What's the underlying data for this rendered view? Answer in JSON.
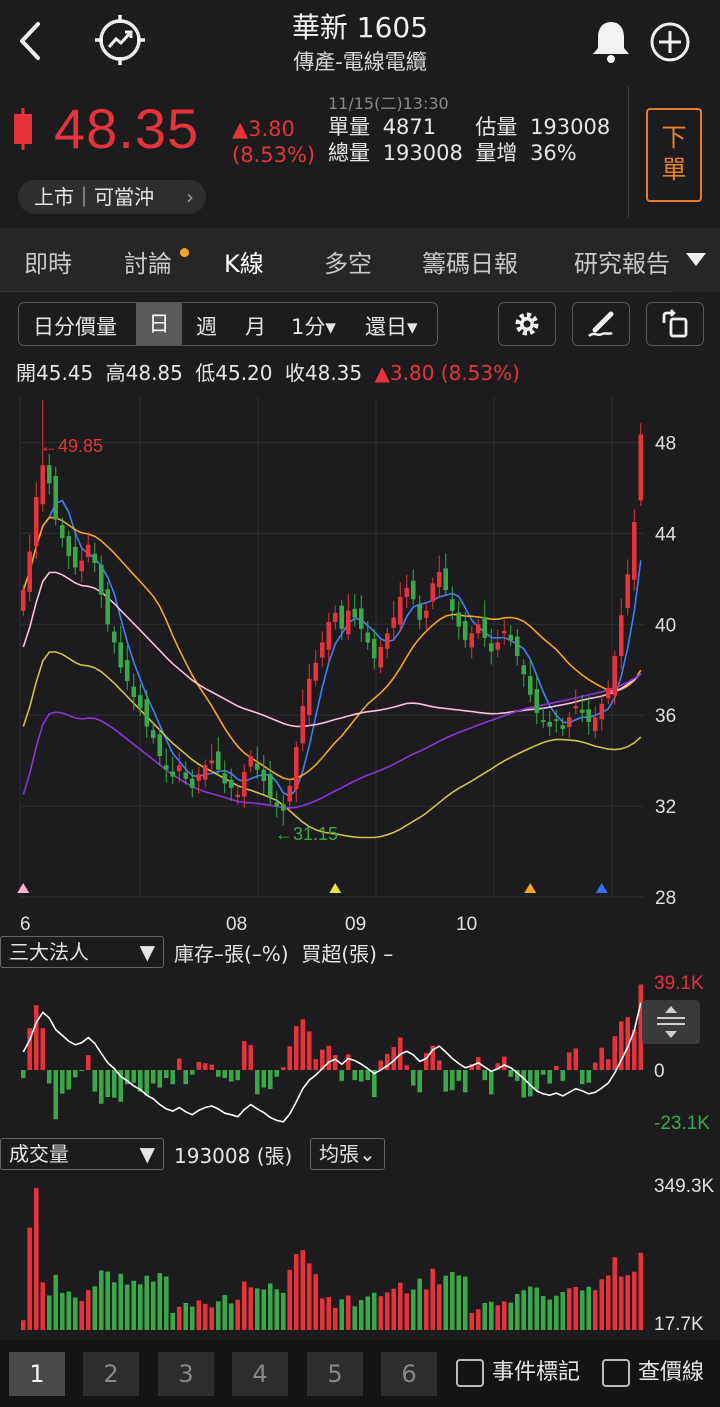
{
  "header": {
    "title": "華新 1605",
    "subtitle": "傳產-電線電纜",
    "icons": [
      "back-icon",
      "trend-compass-icon",
      "bell-icon",
      "plus-circle-icon"
    ]
  },
  "quote": {
    "price": "48.35",
    "change": "▲3.80",
    "change_pct": "(8.53%)",
    "time": "11/15(二)13:30",
    "single_vol_label": "單量",
    "single_vol": "4871",
    "est_label": "估量",
    "est": "193008",
    "total_vol_label": "總量",
    "total_vol": "193008",
    "vol_inc_label": "量增",
    "vol_inc": "36%",
    "order_label_1": "下",
    "order_label_2": "單",
    "market": "上市｜可當沖",
    "colors": {
      "up": "#e5323b",
      "down": "#3aa84a",
      "accent": "#e8802a"
    }
  },
  "tabs": [
    {
      "label": "即時"
    },
    {
      "label": "討論"
    },
    {
      "label": "K線"
    },
    {
      "label": "多空"
    },
    {
      "label": "籌碼日報"
    },
    {
      "label": "研究報告"
    }
  ],
  "toolbar": {
    "periods": [
      "日分價量",
      "日",
      "週",
      "月",
      "1分▾",
      "還日▾"
    ],
    "selected": "日"
  },
  "ohlc": {
    "open_label": "開",
    "open": "45.45",
    "high_label": "高",
    "high": "48.85",
    "low_label": "低",
    "low": "45.20",
    "close_label": "收",
    "close": "48.35",
    "change": "▲3.80 (8.53%)"
  },
  "chart_data": [
    {
      "type": "candlestick",
      "y_ticks": [
        "48",
        "44",
        "40",
        "36",
        "32",
        "28"
      ],
      "ylim": [
        28,
        50
      ],
      "x_ticks": [
        "6",
        "08",
        "09",
        "10"
      ],
      "annotations": {
        "high_mark": "←49.85",
        "low_mark": "←31.15"
      },
      "closes": [
        41.5,
        43.2,
        45.6,
        47.0,
        46.2,
        44.6,
        43.8,
        43.0,
        42.5,
        42.8,
        43.5,
        42.7,
        41.3,
        40.0,
        39.2,
        38.1,
        37.5,
        36.8,
        36.3,
        35.5,
        35.0,
        34.2,
        33.6,
        33.3,
        33.8,
        33.2,
        32.8,
        33.4,
        33.8,
        34.0,
        33.6,
        33.0,
        32.8,
        32.5,
        33.5,
        34.2,
        33.6,
        33.1,
        32.4,
        32.0,
        31.8,
        32.9,
        34.6,
        36.4,
        37.6,
        38.3,
        39.2,
        40.1,
        40.5,
        39.8,
        40.6,
        40.3,
        39.8,
        39.2,
        38.5,
        39.0,
        39.6,
        40.3,
        41.2,
        41.6,
        41.1,
        40.2,
        40.6,
        41.8,
        42.3,
        41.5,
        40.6,
        39.9,
        39.3,
        39.6,
        40.0,
        39.4,
        38.8,
        39.2,
        39.7,
        39.3,
        38.6,
        37.8,
        36.9,
        36.1,
        35.7,
        35.5,
        35.8,
        35.4,
        35.9,
        36.4,
        36.1,
        35.7,
        35.9,
        36.5,
        37.2,
        38.6,
        40.4,
        42.2,
        44.5,
        48.35
      ],
      "ma_series": [
        {
          "color": "#3b82f6"
        },
        {
          "color": "#f5a623"
        },
        {
          "color": "#ffc0e0"
        },
        {
          "color": "#cfc34a"
        },
        {
          "color": "#8b35d6"
        }
      ],
      "signals": [
        {
          "index": 0,
          "color": "#ffb3d9"
        },
        {
          "index": 48,
          "color": "#e8e83a"
        },
        {
          "index": 78,
          "color": "#f5a623"
        },
        {
          "index": 89,
          "color": "#3b6cf6"
        }
      ]
    },
    {
      "type": "bar",
      "y_ticks": [
        "39.1K",
        "0",
        "-23.1K"
      ],
      "ylim": [
        -23.1,
        39.1
      ]
    },
    {
      "type": "bar",
      "y_ticks": [
        "349.3K",
        "17.7K"
      ],
      "ylim": [
        17.7,
        349.3
      ]
    }
  ],
  "institutional": {
    "select": "三大法人",
    "caption": "庫存–張(–%)  買超(張) –"
  },
  "volume": {
    "select": "成交量",
    "value": "193008 (張)",
    "avg_btn": "均張⌄"
  },
  "footer": {
    "pages": [
      "1",
      "2",
      "3",
      "4",
      "5",
      "6"
    ],
    "event_label": "事件標記",
    "price_label": "查價線"
  }
}
